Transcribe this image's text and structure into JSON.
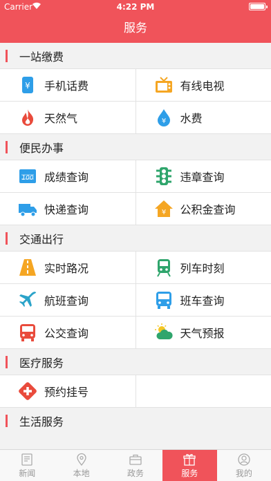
{
  "status": {
    "carrier": "Carrier",
    "time": "4:22 PM"
  },
  "nav": {
    "title": "服务"
  },
  "sections": [
    {
      "title": "一站缴费",
      "rows": [
        [
          {
            "label": "手机话费",
            "icon": "mobile-bill-icon"
          },
          {
            "label": "有线电视",
            "icon": "tv-icon"
          }
        ],
        [
          {
            "label": "天然气",
            "icon": "gas-flame-icon"
          },
          {
            "label": "水费",
            "icon": "water-drop-icon"
          }
        ]
      ]
    },
    {
      "title": "便民办事",
      "rows": [
        [
          {
            "label": "成绩查询",
            "icon": "score-icon"
          },
          {
            "label": "违章查询",
            "icon": "traffic-light-icon"
          }
        ],
        [
          {
            "label": "快递查询",
            "icon": "delivery-truck-icon"
          },
          {
            "label": "公积金查询",
            "icon": "housing-fund-icon"
          }
        ]
      ]
    },
    {
      "title": "交通出行",
      "rows": [
        [
          {
            "label": "实时路况",
            "icon": "road-icon"
          },
          {
            "label": "列车时刻",
            "icon": "train-icon"
          }
        ],
        [
          {
            "label": "航班查询",
            "icon": "airplane-icon"
          },
          {
            "label": "班车查询",
            "icon": "shuttle-bus-icon"
          }
        ],
        [
          {
            "label": "公交查询",
            "icon": "bus-icon"
          },
          {
            "label": "天气预报",
            "icon": "weather-icon"
          }
        ]
      ]
    },
    {
      "title": "医疗服务",
      "rows": [
        [
          {
            "label": "预约挂号",
            "icon": "medical-cross-icon"
          },
          {
            "label": "",
            "icon": ""
          }
        ]
      ]
    },
    {
      "title": "生活服务",
      "rows": []
    }
  ],
  "tabs": [
    {
      "label": "新闻",
      "icon": "news-icon",
      "active": false
    },
    {
      "label": "本地",
      "icon": "location-pin-icon",
      "active": false
    },
    {
      "label": "政务",
      "icon": "briefcase-icon",
      "active": false
    },
    {
      "label": "服务",
      "icon": "gift-icon",
      "active": true
    },
    {
      "label": "我的",
      "icon": "user-icon",
      "active": false
    }
  ],
  "colors": {
    "brand": "#f0535a"
  }
}
